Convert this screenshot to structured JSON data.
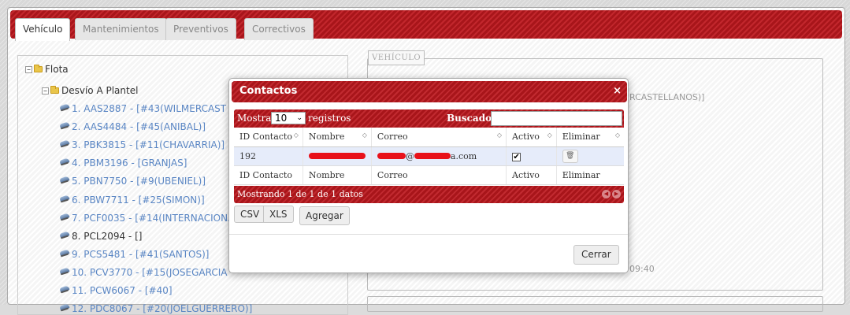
{
  "tabs": [
    "Vehículo",
    "Mantenimientos",
    "Preventivos",
    "Correctivos"
  ],
  "tree": {
    "root": "Flota",
    "group": "Desvío A Plantel",
    "items": [
      {
        "text": "1. AAS2887 - [#43(WILMERCAST",
        "linked": true
      },
      {
        "text": "2. AAS4484 - [#45(ANIBAL)]",
        "linked": true
      },
      {
        "text": "3. PBK3815 - [#11(CHAVARRIA)]",
        "linked": true
      },
      {
        "text": "4. PBM3196 - [GRANJAS]",
        "linked": true
      },
      {
        "text": "5. PBN7750 - [#9(UBENIEL)]",
        "linked": true
      },
      {
        "text": "6. PBW7711 - [#25(SIMON)]",
        "linked": true
      },
      {
        "text": "7. PCF0035 - [#14(INTERNACIONA",
        "linked": true
      },
      {
        "text": "8. PCL2094 - []",
        "linked": false
      },
      {
        "text": "9. PCS5481 - [#41(SANTOS)]",
        "linked": true
      },
      {
        "text": "10. PCV3770 - [#15(JOSEGARCIA",
        "linked": true
      },
      {
        "text": "11. PCW6067 - [#40]",
        "linked": true
      },
      {
        "text": "12. PDC8067 - [#20(JOELGUERRERO)]",
        "linked": true
      }
    ]
  },
  "vehiculo": {
    "legend": "VEHÍCULO",
    "partial_text_1": "RCASTELLANOS)]",
    "partial_text_2": "09:40"
  },
  "modal": {
    "title": "Contactos",
    "close": "×",
    "length_prefix": "Mostrar",
    "length_value": "10",
    "length_suffix": "registros",
    "search_label": "Buscador:",
    "search_value": "",
    "columns": [
      "ID Contacto",
      "Nombre",
      "Correo",
      "Activo",
      "Eliminar"
    ],
    "rows": [
      {
        "id": "192",
        "nombre": "",
        "correo_visible_1": "@",
        "correo_visible_2": "a.com",
        "activo": "✔",
        "eliminar": "🗑"
      }
    ],
    "info": "Mostrando 1 de 1 de 1 datos",
    "export_buttons": [
      "CSV",
      "XLS"
    ],
    "add_button": "Agregar",
    "close_button": "Cerrar"
  }
}
